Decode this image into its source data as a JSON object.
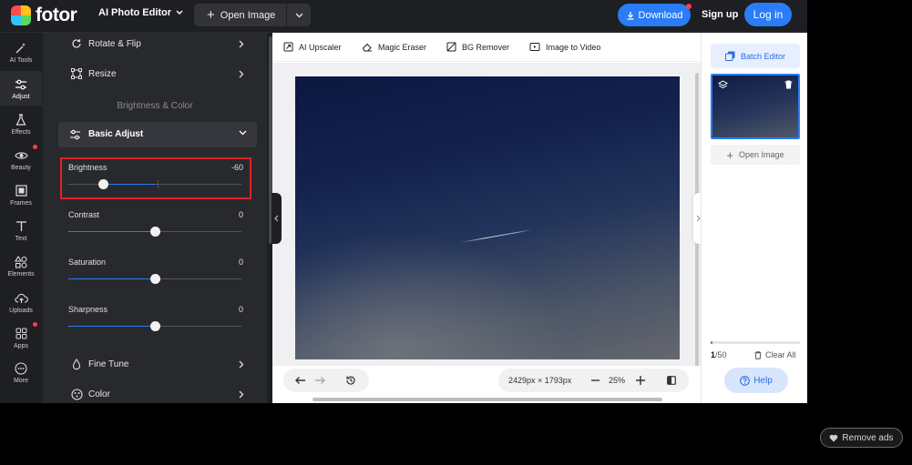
{
  "header": {
    "brand": "fotor",
    "app_switcher": "AI Photo Editor",
    "open_image": "Open Image",
    "download": "Download",
    "sign_up": "Sign up",
    "log_in": "Log in"
  },
  "rail": {
    "items": [
      {
        "label": "AI Tools",
        "icon": "magic-wand-icon"
      },
      {
        "label": "Adjust",
        "icon": "sliders-icon",
        "active": true
      },
      {
        "label": "Effects",
        "icon": "flask-icon"
      },
      {
        "label": "Beauty",
        "icon": "eye-icon"
      },
      {
        "label": "Frames",
        "icon": "frame-icon"
      },
      {
        "label": "Text",
        "icon": "text-icon"
      },
      {
        "label": "Elements",
        "icon": "shapes-icon"
      },
      {
        "label": "Uploads",
        "icon": "cloud-upload-icon"
      },
      {
        "label": "Apps",
        "icon": "apps-icon"
      },
      {
        "label": "More",
        "icon": "more-icon"
      }
    ]
  },
  "panel": {
    "rotate_flip": "Rotate & Flip",
    "resize": "Resize",
    "section_title": "Brightness & Color",
    "basic_adjust": "Basic Adjust",
    "sliders": [
      {
        "label": "Brightness",
        "value": "-60",
        "numeric": -60
      },
      {
        "label": "Contrast",
        "value": "0",
        "numeric": 0
      },
      {
        "label": "Saturation",
        "value": "0",
        "numeric": 0
      },
      {
        "label": "Sharpness",
        "value": "0",
        "numeric": 0
      }
    ],
    "fine_tune": "Fine Tune",
    "color": "Color"
  },
  "toolstrip": {
    "ai_upscaler": "AI Upscaler",
    "magic_eraser": "Magic Eraser",
    "bg_remover": "BG Remover",
    "image_to_video": "Image to Video"
  },
  "bottombar": {
    "dimensions": "2429px × 1793px",
    "zoom": "25%"
  },
  "right_panel": {
    "batch_editor": "Batch Editor",
    "open_image": "Open Image",
    "count_current": "1",
    "count_total": "/50",
    "progress": 0.02,
    "clear_all": "Clear All",
    "help": "Help"
  },
  "remove_ads": "Remove ads",
  "colors": {
    "accent": "#2a7cf7",
    "highlight_box": "#e02222",
    "notification_dot": "#ff3b5c"
  }
}
